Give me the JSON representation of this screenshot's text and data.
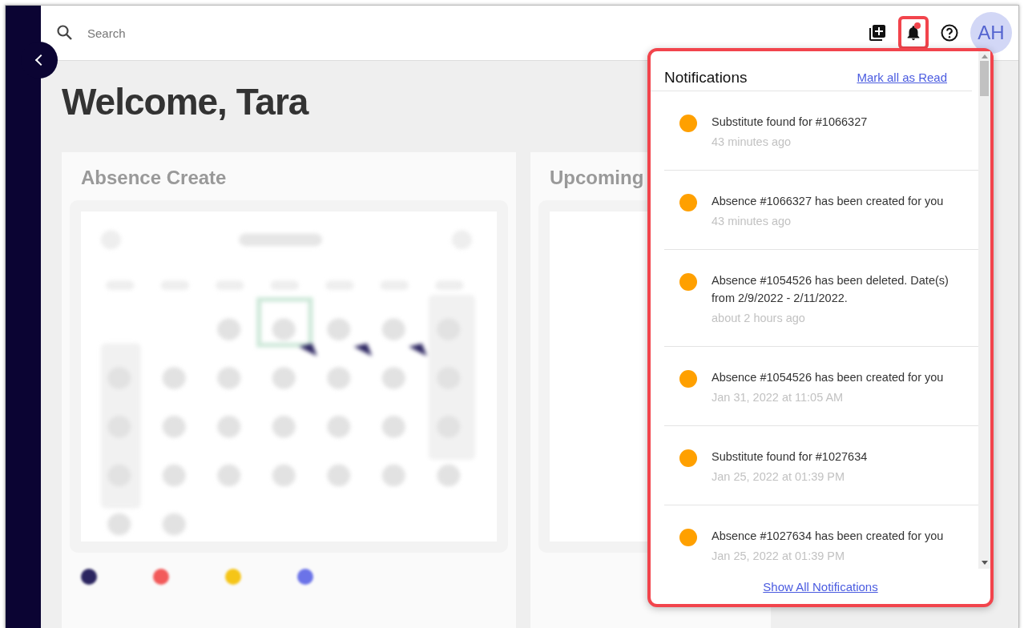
{
  "top_bar": {
    "search": {
      "placeholder": "Search"
    },
    "avatar": "AH",
    "bell": {
      "has_unread": true
    }
  },
  "page": {
    "title": "Welcome, Tara",
    "cards": [
      {
        "title": "Absence Create"
      },
      {
        "title": "Upcoming"
      }
    ]
  },
  "legend": [
    {
      "color": "#2b2560"
    },
    {
      "color": "#f25a5a"
    },
    {
      "color": "#f5c518"
    },
    {
      "color": "#6b73e8"
    }
  ],
  "notifications": {
    "title": "Notifications",
    "mark_all": "Mark all as Read",
    "footer": "Show All Notifications",
    "items": [
      {
        "text": "Substitute found for #1066327",
        "time": "43 minutes ago",
        "unread": true
      },
      {
        "text": "Absence #1066327 has been created for you",
        "time": "43 minutes ago",
        "unread": true
      },
      {
        "text": "Absence #1054526 has been deleted. Date(s) from 2/9/2022 - 2/11/2022.",
        "time": "about 2 hours ago",
        "unread": true
      },
      {
        "text": "Absence #1054526 has been created for you",
        "time": "Jan 31, 2022 at 11:05 AM",
        "unread": true
      },
      {
        "text": "Substitute found for #1027634",
        "time": "Jan 25, 2022 at 01:39 PM",
        "unread": true
      },
      {
        "text": "Absence #1027634 has been created for you",
        "time": "Jan 25, 2022 at 01:39 PM",
        "unread": true
      }
    ]
  }
}
